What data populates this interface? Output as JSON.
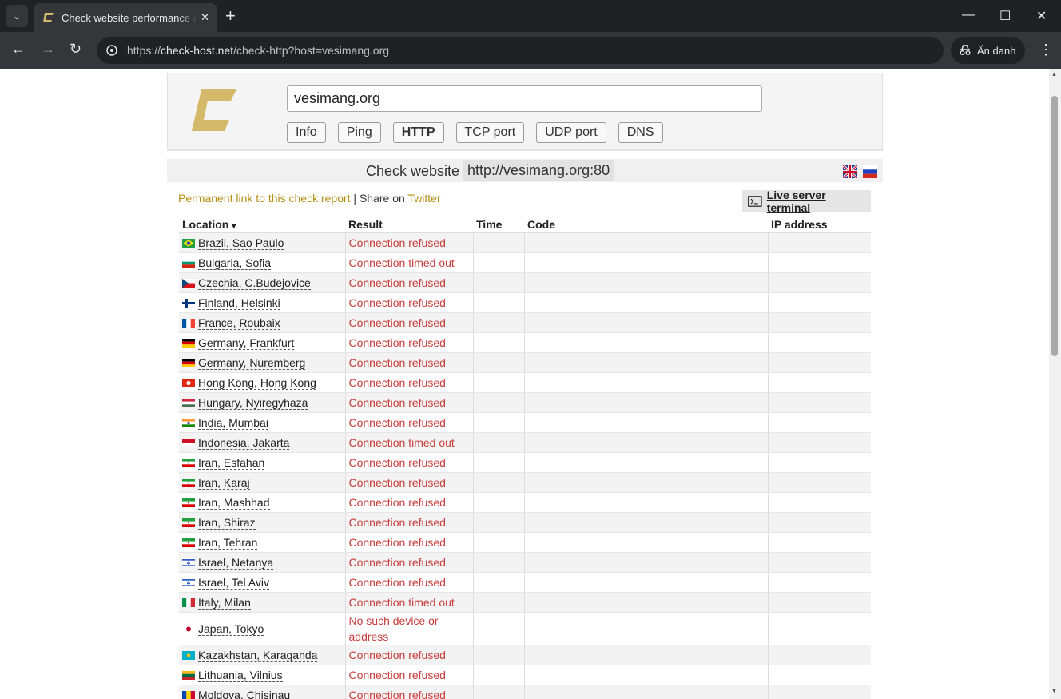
{
  "browser": {
    "tab_title": "Check website performance and",
    "url_scheme": "https://",
    "url_host": "check-host.net",
    "url_path": "/check-http?host=vesimang.org",
    "incognito_label": "Ẩn danh"
  },
  "header": {
    "host_value": "vesimang.org",
    "nav": [
      "Info",
      "Ping",
      "HTTP",
      "TCP port",
      "UDP port",
      "DNS"
    ],
    "active_nav": "HTTP",
    "logo_color": "#d4b96a"
  },
  "check": {
    "label": "Check website",
    "target": "http://vesimang.org:80"
  },
  "links": {
    "permalink": "Permanent link to this check report",
    "separator": " | Share on ",
    "twitter": "Twitter",
    "terminal": "Live server terminal"
  },
  "table": {
    "headers": [
      "Location",
      "Result",
      "Time",
      "Code",
      "IP address"
    ],
    "sort_indicator": "▾",
    "rows": [
      {
        "flag": "br",
        "location": "Brazil, Sao Paulo",
        "result": "Connection refused"
      },
      {
        "flag": "bg",
        "location": "Bulgaria, Sofia",
        "result": "Connection timed out"
      },
      {
        "flag": "cz",
        "location": "Czechia, C.Budejovice",
        "result": "Connection refused"
      },
      {
        "flag": "fi",
        "location": "Finland, Helsinki",
        "result": "Connection refused"
      },
      {
        "flag": "fr",
        "location": "France, Roubaix",
        "result": "Connection refused"
      },
      {
        "flag": "de",
        "location": "Germany, Frankfurt",
        "result": "Connection refused"
      },
      {
        "flag": "de",
        "location": "Germany, Nuremberg",
        "result": "Connection refused"
      },
      {
        "flag": "hk",
        "location": "Hong Kong, Hong Kong",
        "result": "Connection refused"
      },
      {
        "flag": "hu",
        "location": "Hungary, Nyiregyhaza",
        "result": "Connection refused"
      },
      {
        "flag": "in",
        "location": "India, Mumbai",
        "result": "Connection refused"
      },
      {
        "flag": "id",
        "location": "Indonesia, Jakarta",
        "result": "Connection timed out"
      },
      {
        "flag": "ir",
        "location": "Iran, Esfahan",
        "result": "Connection refused"
      },
      {
        "flag": "ir",
        "location": "Iran, Karaj",
        "result": "Connection refused"
      },
      {
        "flag": "ir",
        "location": "Iran, Mashhad",
        "result": "Connection refused"
      },
      {
        "flag": "ir",
        "location": "Iran, Shiraz",
        "result": "Connection refused"
      },
      {
        "flag": "ir",
        "location": "Iran, Tehran",
        "result": "Connection refused"
      },
      {
        "flag": "il",
        "location": "Israel, Netanya",
        "result": "Connection refused"
      },
      {
        "flag": "il",
        "location": "Israel, Tel Aviv",
        "result": "Connection refused"
      },
      {
        "flag": "it",
        "location": "Italy, Milan",
        "result": "Connection timed out"
      },
      {
        "flag": "jp",
        "location": "Japan, Tokyo",
        "result": "No such device or address"
      },
      {
        "flag": "kz",
        "location": "Kazakhstan, Karaganda",
        "result": "Connection refused"
      },
      {
        "flag": "lt",
        "location": "Lithuania, Vilnius",
        "result": "Connection refused"
      },
      {
        "flag": "md",
        "location": "Moldova, Chisinau",
        "result": "Connection refused"
      }
    ]
  },
  "colors": {
    "link_gold": "#b38e10",
    "error_red": "#c83c3c",
    "chrome_dark": "#202124"
  }
}
